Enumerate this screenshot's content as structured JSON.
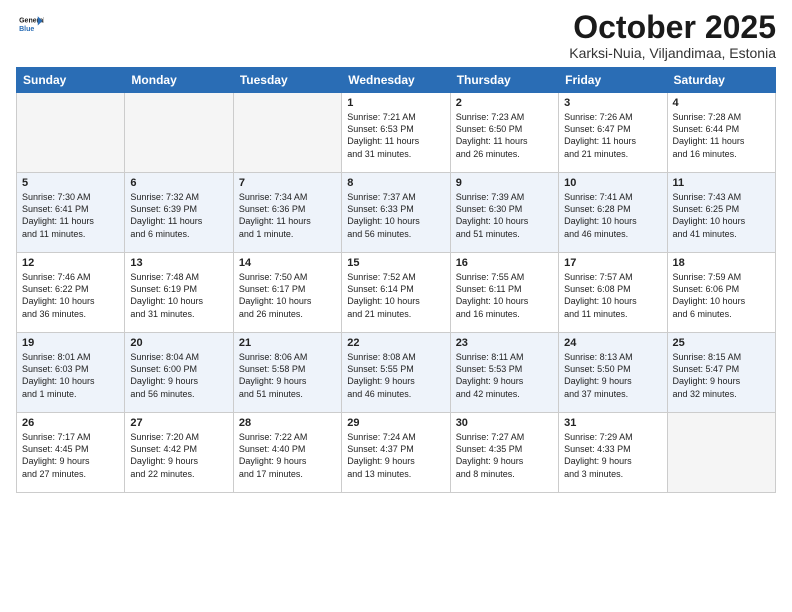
{
  "header": {
    "logo_line1": "General",
    "logo_line2": "Blue",
    "month": "October 2025",
    "location": "Karksi-Nuia, Viljandimaa, Estonia"
  },
  "weekdays": [
    "Sunday",
    "Monday",
    "Tuesday",
    "Wednesday",
    "Thursday",
    "Friday",
    "Saturday"
  ],
  "weeks": [
    [
      {
        "day": "",
        "info": ""
      },
      {
        "day": "",
        "info": ""
      },
      {
        "day": "",
        "info": ""
      },
      {
        "day": "1",
        "info": "Sunrise: 7:21 AM\nSunset: 6:53 PM\nDaylight: 11 hours\nand 31 minutes."
      },
      {
        "day": "2",
        "info": "Sunrise: 7:23 AM\nSunset: 6:50 PM\nDaylight: 11 hours\nand 26 minutes."
      },
      {
        "day": "3",
        "info": "Sunrise: 7:26 AM\nSunset: 6:47 PM\nDaylight: 11 hours\nand 21 minutes."
      },
      {
        "day": "4",
        "info": "Sunrise: 7:28 AM\nSunset: 6:44 PM\nDaylight: 11 hours\nand 16 minutes."
      }
    ],
    [
      {
        "day": "5",
        "info": "Sunrise: 7:30 AM\nSunset: 6:41 PM\nDaylight: 11 hours\nand 11 minutes."
      },
      {
        "day": "6",
        "info": "Sunrise: 7:32 AM\nSunset: 6:39 PM\nDaylight: 11 hours\nand 6 minutes."
      },
      {
        "day": "7",
        "info": "Sunrise: 7:34 AM\nSunset: 6:36 PM\nDaylight: 11 hours\nand 1 minute."
      },
      {
        "day": "8",
        "info": "Sunrise: 7:37 AM\nSunset: 6:33 PM\nDaylight: 10 hours\nand 56 minutes."
      },
      {
        "day": "9",
        "info": "Sunrise: 7:39 AM\nSunset: 6:30 PM\nDaylight: 10 hours\nand 51 minutes."
      },
      {
        "day": "10",
        "info": "Sunrise: 7:41 AM\nSunset: 6:28 PM\nDaylight: 10 hours\nand 46 minutes."
      },
      {
        "day": "11",
        "info": "Sunrise: 7:43 AM\nSunset: 6:25 PM\nDaylight: 10 hours\nand 41 minutes."
      }
    ],
    [
      {
        "day": "12",
        "info": "Sunrise: 7:46 AM\nSunset: 6:22 PM\nDaylight: 10 hours\nand 36 minutes."
      },
      {
        "day": "13",
        "info": "Sunrise: 7:48 AM\nSunset: 6:19 PM\nDaylight: 10 hours\nand 31 minutes."
      },
      {
        "day": "14",
        "info": "Sunrise: 7:50 AM\nSunset: 6:17 PM\nDaylight: 10 hours\nand 26 minutes."
      },
      {
        "day": "15",
        "info": "Sunrise: 7:52 AM\nSunset: 6:14 PM\nDaylight: 10 hours\nand 21 minutes."
      },
      {
        "day": "16",
        "info": "Sunrise: 7:55 AM\nSunset: 6:11 PM\nDaylight: 10 hours\nand 16 minutes."
      },
      {
        "day": "17",
        "info": "Sunrise: 7:57 AM\nSunset: 6:08 PM\nDaylight: 10 hours\nand 11 minutes."
      },
      {
        "day": "18",
        "info": "Sunrise: 7:59 AM\nSunset: 6:06 PM\nDaylight: 10 hours\nand 6 minutes."
      }
    ],
    [
      {
        "day": "19",
        "info": "Sunrise: 8:01 AM\nSunset: 6:03 PM\nDaylight: 10 hours\nand 1 minute."
      },
      {
        "day": "20",
        "info": "Sunrise: 8:04 AM\nSunset: 6:00 PM\nDaylight: 9 hours\nand 56 minutes."
      },
      {
        "day": "21",
        "info": "Sunrise: 8:06 AM\nSunset: 5:58 PM\nDaylight: 9 hours\nand 51 minutes."
      },
      {
        "day": "22",
        "info": "Sunrise: 8:08 AM\nSunset: 5:55 PM\nDaylight: 9 hours\nand 46 minutes."
      },
      {
        "day": "23",
        "info": "Sunrise: 8:11 AM\nSunset: 5:53 PM\nDaylight: 9 hours\nand 42 minutes."
      },
      {
        "day": "24",
        "info": "Sunrise: 8:13 AM\nSunset: 5:50 PM\nDaylight: 9 hours\nand 37 minutes."
      },
      {
        "day": "25",
        "info": "Sunrise: 8:15 AM\nSunset: 5:47 PM\nDaylight: 9 hours\nand 32 minutes."
      }
    ],
    [
      {
        "day": "26",
        "info": "Sunrise: 7:17 AM\nSunset: 4:45 PM\nDaylight: 9 hours\nand 27 minutes."
      },
      {
        "day": "27",
        "info": "Sunrise: 7:20 AM\nSunset: 4:42 PM\nDaylight: 9 hours\nand 22 minutes."
      },
      {
        "day": "28",
        "info": "Sunrise: 7:22 AM\nSunset: 4:40 PM\nDaylight: 9 hours\nand 17 minutes."
      },
      {
        "day": "29",
        "info": "Sunrise: 7:24 AM\nSunset: 4:37 PM\nDaylight: 9 hours\nand 13 minutes."
      },
      {
        "day": "30",
        "info": "Sunrise: 7:27 AM\nSunset: 4:35 PM\nDaylight: 9 hours\nand 8 minutes."
      },
      {
        "day": "31",
        "info": "Sunrise: 7:29 AM\nSunset: 4:33 PM\nDaylight: 9 hours\nand 3 minutes."
      },
      {
        "day": "",
        "info": ""
      }
    ]
  ]
}
